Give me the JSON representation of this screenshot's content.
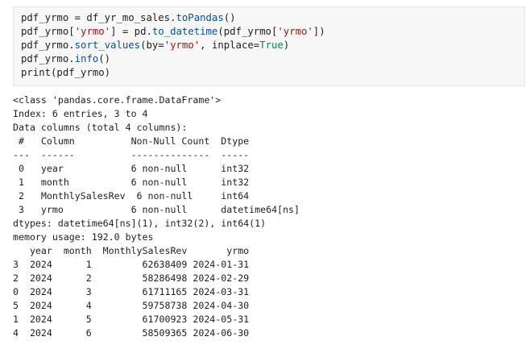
{
  "code_cell": {
    "lines": [
      [
        {
          "t": "plain",
          "v": "pdf_yrmo = df_yr_mo_sales."
        },
        {
          "t": "attr",
          "v": "toPandas"
        },
        {
          "t": "plain",
          "v": "()"
        }
      ],
      [
        {
          "t": "plain",
          "v": "pdf_yrmo["
        },
        {
          "t": "str",
          "v": "'yrmo'"
        },
        {
          "t": "plain",
          "v": "] = pd."
        },
        {
          "t": "attr",
          "v": "to_datetime"
        },
        {
          "t": "plain",
          "v": "(pdf_yrmo["
        },
        {
          "t": "str",
          "v": "'yrmo'"
        },
        {
          "t": "plain",
          "v": "])"
        }
      ],
      [
        {
          "t": "plain",
          "v": "pdf_yrmo."
        },
        {
          "t": "attr",
          "v": "sort_values"
        },
        {
          "t": "plain",
          "v": "(by="
        },
        {
          "t": "str",
          "v": "'yrmo'"
        },
        {
          "t": "plain",
          "v": ", inplace="
        },
        {
          "t": "kw",
          "v": "True"
        },
        {
          "t": "plain",
          "v": ")"
        }
      ],
      [
        {
          "t": "plain",
          "v": "pdf_yrmo."
        },
        {
          "t": "attr",
          "v": "info"
        },
        {
          "t": "plain",
          "v": "()"
        }
      ],
      [
        {
          "t": "plain",
          "v": "print(pdf_yrmo)"
        }
      ]
    ]
  },
  "output": {
    "lines": [
      "<class 'pandas.core.frame.DataFrame'>",
      "Index: 6 entries, 3 to 4",
      "Data columns (total 4 columns):",
      " #   Column          Non-Null Count  Dtype",
      "---  ------          --------------  -----",
      " 0   year            6 non-null      int32",
      " 1   month           6 non-null      int32",
      " 2   MonthlySalesRev  6 non-null     int64",
      " 3   yrmo            6 non-null      datetime64[ns]",
      "dtypes: datetime64[ns](1), int32(2), int64(1)",
      "memory usage: 192.0 bytes",
      "   year  month  MonthlySalesRev       yrmo",
      "3  2024      1         62638409 2024-01-31",
      "2  2024      2         58286498 2024-02-29",
      "0  2024      3         61711165 2024-03-31",
      "5  2024      4         59758738 2024-04-30",
      "1  2024      5         61700923 2024-05-31",
      "4  2024      6         58509365 2024-06-30"
    ]
  },
  "colors": {
    "cell_background": "#f7f7f7",
    "string": "#a31515",
    "attribute": "#0451a5",
    "keyword": "#098658",
    "text": "#1f1f1f"
  }
}
